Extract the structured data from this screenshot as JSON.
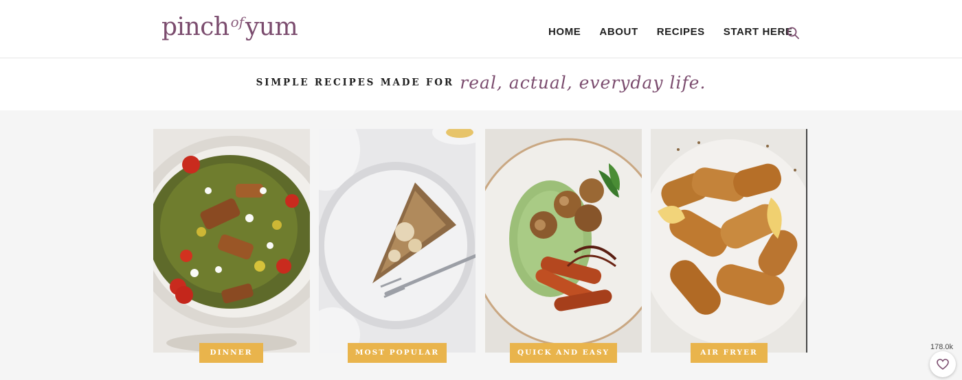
{
  "header": {
    "logo": {
      "part1": "pinch",
      "part2": "of",
      "part3": "yum"
    },
    "nav": [
      {
        "label": "HOME"
      },
      {
        "label": "ABOUT"
      },
      {
        "label": "RECIPES"
      },
      {
        "label": "START HERE"
      }
    ],
    "search_icon": "search-icon"
  },
  "tagline": {
    "caps": "SIMPLE RECIPES MADE FOR",
    "script": "real, actual, everyday life."
  },
  "categories": [
    {
      "label": "DINNER",
      "image": "salad-bowl-photo"
    },
    {
      "label": "MOST POPULAR",
      "image": "coffee-cake-slice-photo"
    },
    {
      "label": "QUICK AND EASY",
      "image": "potatoes-sweet-potato-plate-photo"
    },
    {
      "label": "AIR FRYER",
      "image": "air-fryer-chicken-tenders-photo"
    }
  ],
  "likes": {
    "count": "178.0k",
    "icon": "heart-icon"
  },
  "colors": {
    "brand_plum": "#7b4c6e",
    "badge_gold": "#e9b44c",
    "band_gray": "#f5f5f5"
  }
}
